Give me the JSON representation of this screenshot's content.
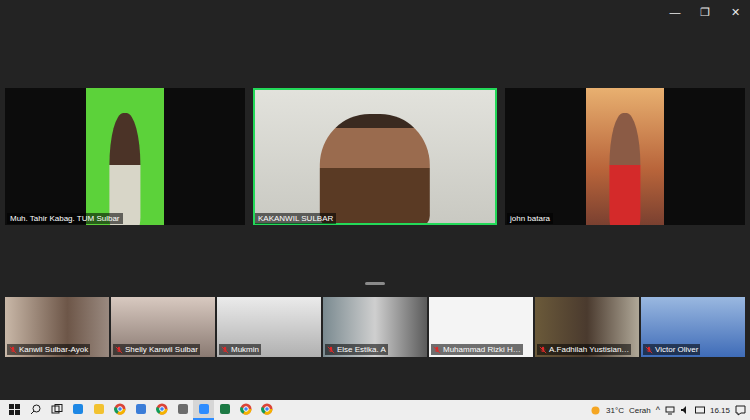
{
  "window": {
    "controls": [
      "—",
      "❐",
      "✕"
    ]
  },
  "speakers": [
    {
      "name": "Muh.  Tahir  Kabag. TUM Sulbar",
      "active": false,
      "kind": "portrait"
    },
    {
      "name": "KAKANWIL SULBAR",
      "active": true,
      "kind": "wide"
    },
    {
      "name": "john batara",
      "active": false,
      "kind": "portrait"
    }
  ],
  "participants": [
    {
      "name": "Kanwil Sulbar-Ayok",
      "muted": true
    },
    {
      "name": "Shelly Kanwil Sulbar",
      "muted": true
    },
    {
      "name": "Mukmin",
      "muted": true
    },
    {
      "name": "Else Estika. A",
      "muted": true
    },
    {
      "name": "Muhammad Rizki H…",
      "muted": true
    },
    {
      "name": "A.Fadhilah Yustisian…",
      "muted": true
    },
    {
      "name": "Victor Oliver",
      "muted": true
    }
  ],
  "taskbar": {
    "apps": [
      {
        "kind": "start",
        "active": false
      },
      {
        "kind": "search",
        "active": false
      },
      {
        "kind": "taskview",
        "active": false
      },
      {
        "kind": "edge",
        "active": false
      },
      {
        "kind": "explorer",
        "active": false
      },
      {
        "kind": "chrome",
        "active": false
      },
      {
        "kind": "mail",
        "active": false
      },
      {
        "kind": "chrome",
        "active": false
      },
      {
        "kind": "app",
        "active": false
      },
      {
        "kind": "zoom",
        "active": true
      },
      {
        "kind": "excel",
        "active": false
      },
      {
        "kind": "chrome",
        "active": false
      },
      {
        "kind": "chrome",
        "active": false
      }
    ],
    "weather": {
      "temp": "31°C",
      "condition": "Cerah"
    },
    "tray_chevron": "^",
    "time": "16.15"
  }
}
